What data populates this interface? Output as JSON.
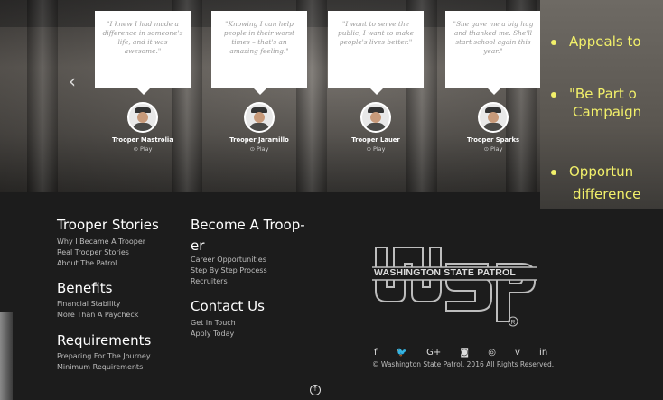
{
  "testimonials": [
    {
      "quote": "\"I knew I had made a difference in someone's life, and it was awesome.\"",
      "name": "Trooper Mastrolia",
      "play": "Play"
    },
    {
      "quote": "\"Knowing I can help people in their worst times – that's an amazing feeling.\"",
      "name": "Trooper Jaramillo",
      "play": "Play"
    },
    {
      "quote": "\"I want to serve the public, I want to make people's lives better.\"",
      "name": "Trooper Lauer",
      "play": "Play"
    },
    {
      "quote": "\"She gave me a big hug and thanked me. She'll start school again this year.\"",
      "name": "Trooper Sparks",
      "play": "Play"
    }
  ],
  "slide_bullets": [
    "Appeals to",
    "\"Be Part o",
    "Campaign",
    "Opportun",
    "difference"
  ],
  "footer": {
    "col1": {
      "h1": "Trooper Stories",
      "l1": [
        "Why I Became A Trooper",
        "Real Trooper Stories",
        "About The Patrol"
      ],
      "h2": "Benefits",
      "l2": [
        "Financial Stability",
        "More Than A Paycheck"
      ],
      "h3": "Requirements",
      "l3": [
        "Preparing For The Journey",
        "Minimum Requirements"
      ]
    },
    "col2": {
      "h1a": "Become A Troop-",
      "h1b": "er",
      "l1": [
        "Career Opportunities",
        "Step By Step Process",
        "Recruiters"
      ],
      "h2": "Contact Us",
      "l2": [
        "Get In Touch",
        "Apply Today"
      ]
    },
    "logo_text": "WASHINGTON STATE PATROL",
    "social": [
      "f",
      "🐦",
      "G+",
      "◙",
      "◎",
      "v",
      "in"
    ],
    "copyright": "© Washington State Patrol, 2016 All Rights Reserved."
  }
}
